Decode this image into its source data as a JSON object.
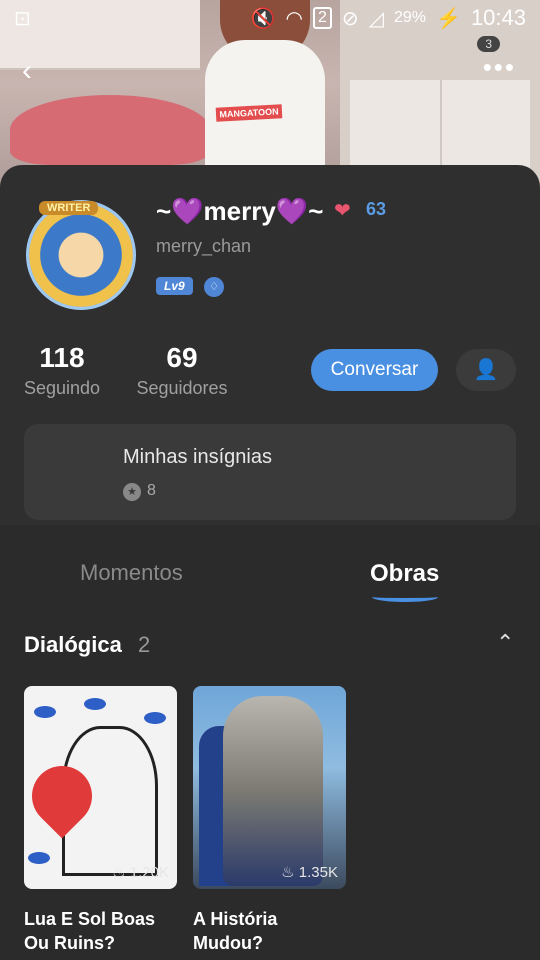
{
  "status_bar": {
    "sim_label": "2",
    "battery": "29%",
    "time": "10:43",
    "notification_count": "3"
  },
  "nav": {
    "back_icon": "chevron-left-icon",
    "more_icon": "more-horizontal-icon"
  },
  "hero": {
    "shirt_text": "MANGATOON"
  },
  "profile": {
    "avatar_badge": "WRITER",
    "display_name": "~💜merry💜~",
    "hearts_count": "63",
    "username": "merry_chan",
    "level": "Lv9"
  },
  "stats": {
    "following_count": "118",
    "following_label": "Seguindo",
    "followers_count": "69",
    "followers_label": "Seguidores"
  },
  "actions": {
    "chat_label": "Conversar",
    "follow_icon": "user-check-icon"
  },
  "badges": {
    "title": "Minhas insígnias",
    "count": "8"
  },
  "tabs": [
    {
      "label": "Momentos",
      "active": false
    },
    {
      "label": "Obras",
      "active": true
    }
  ],
  "section": {
    "title": "Dialógica",
    "count": "2"
  },
  "works": [
    {
      "title": "Lua E Sol Boas Ou Ruins?",
      "views": "1.20K"
    },
    {
      "title": "A História Mudou?",
      "views": "1.35K"
    }
  ],
  "colors": {
    "accent": "#4a90e2",
    "background": "#2b2b2b",
    "card": "#2f2f2f"
  }
}
